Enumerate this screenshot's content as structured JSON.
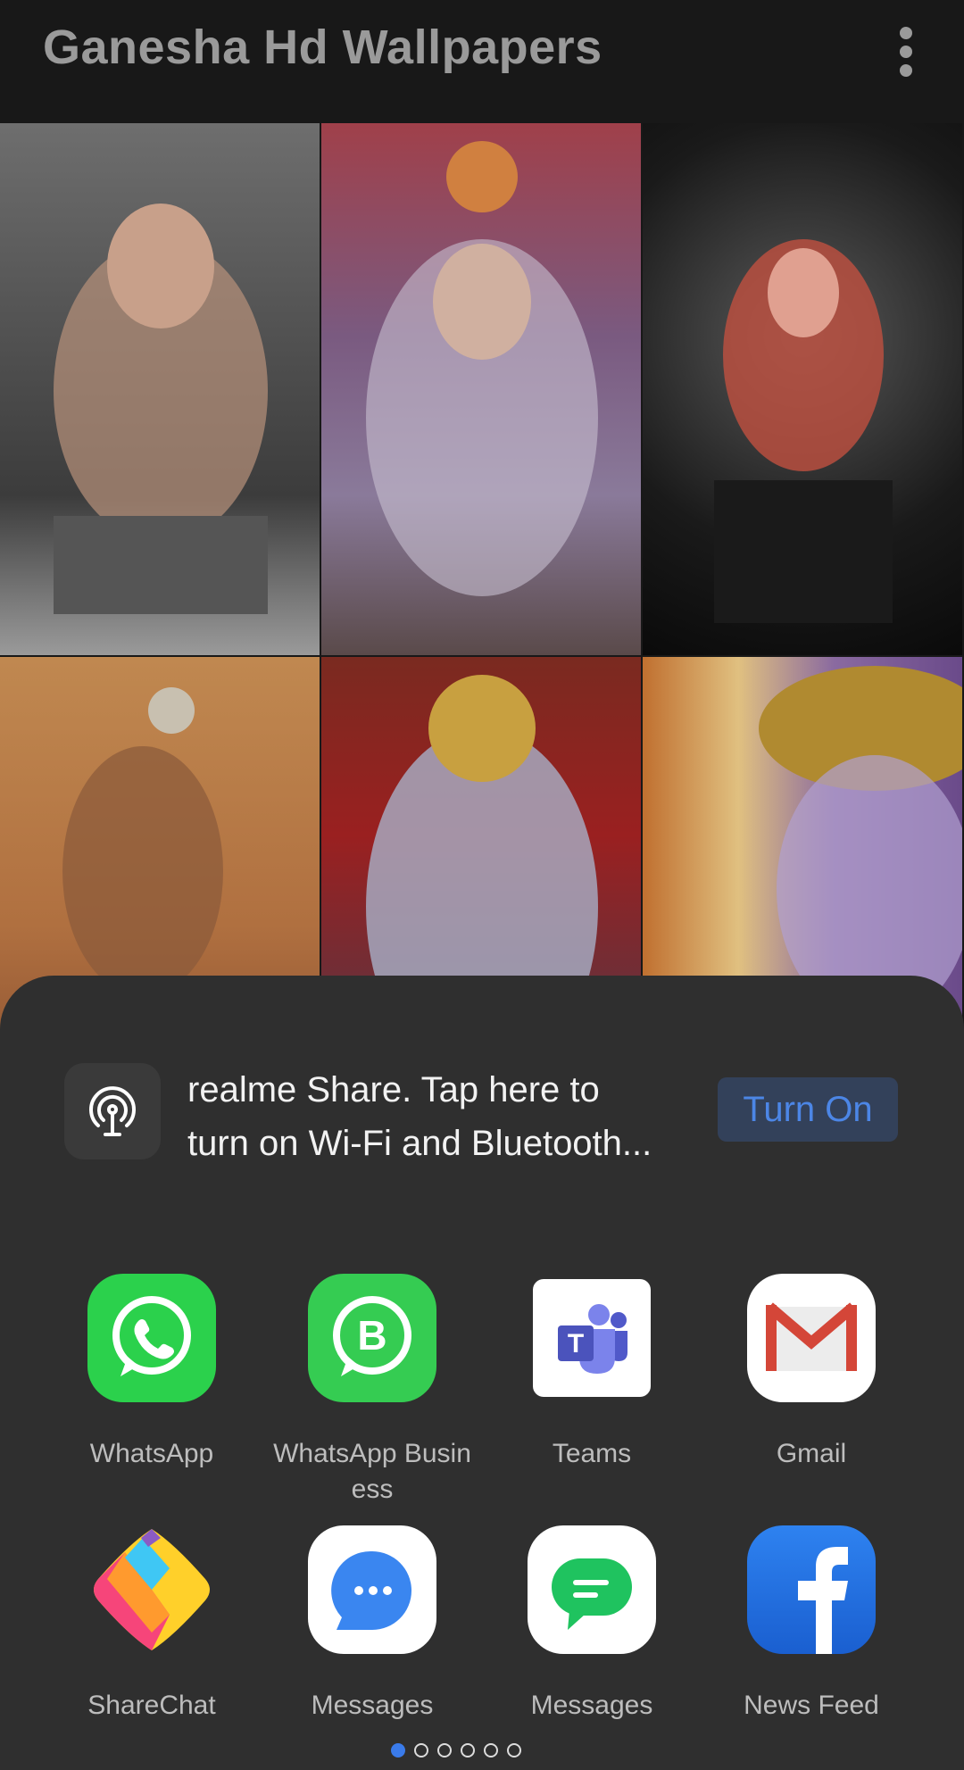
{
  "appbar": {
    "title": "Ganesha Hd Wallpapers",
    "menu_icon": "more-vert-icon"
  },
  "wallpapers": [
    {
      "desc": "Ganesha idol monochrome",
      "colors": [
        "#8a8a8a",
        "#4a4a4a",
        "#c9a080"
      ]
    },
    {
      "desc": "Ganesha pandal with balloons",
      "colors": [
        "#b05030",
        "#8a6aa0",
        "#d0c0b0"
      ]
    },
    {
      "desc": "Ganesha idol dark background",
      "colors": [
        "#101010",
        "#5a5a5a",
        "#c03040"
      ]
    },
    {
      "desc": "Ganesha silhouette at sunset",
      "colors": [
        "#c07a40",
        "#a05830",
        "#e0a060"
      ]
    },
    {
      "desc": "Ganesha blue idol gold crown",
      "colors": [
        "#7a2020",
        "#9aa0c0",
        "#c09030"
      ]
    },
    {
      "desc": "Ganesha close-up face",
      "colors": [
        "#c07030",
        "#7a5a9a",
        "#d0a040"
      ]
    }
  ],
  "share_sheet": {
    "realme_share": {
      "icon": "wireless-antenna-icon",
      "text": "realme Share. Tap here to turn on Wi-Fi and Bluetooth...",
      "line1": "realme Share. Tap here to",
      "line2": "turn on Wi-Fi and Bluetooth...",
      "button": "Turn On"
    },
    "apps": [
      {
        "label": "WhatsApp",
        "icon": "whatsapp-icon"
      },
      {
        "label": "WhatsApp Busin ess",
        "line1": "WhatsApp Busin",
        "line2": "ess",
        "icon": "whatsapp-business-icon"
      },
      {
        "label": "Teams",
        "icon": "teams-icon"
      },
      {
        "label": "Gmail",
        "icon": "gmail-icon"
      },
      {
        "label": "ShareChat",
        "icon": "sharechat-icon"
      },
      {
        "label": "Messages",
        "icon": "messages-blue-icon"
      },
      {
        "label": "Messages",
        "icon": "messages-green-icon"
      },
      {
        "label": "News Feed",
        "icon": "facebook-icon"
      }
    ],
    "pagination": {
      "total": 6,
      "current": 1
    }
  },
  "colors": {
    "accent": "#3a7bea",
    "sheet_bg": "#2f2f2f",
    "button_bg": "#33415a",
    "button_text": "#4c86e6"
  }
}
